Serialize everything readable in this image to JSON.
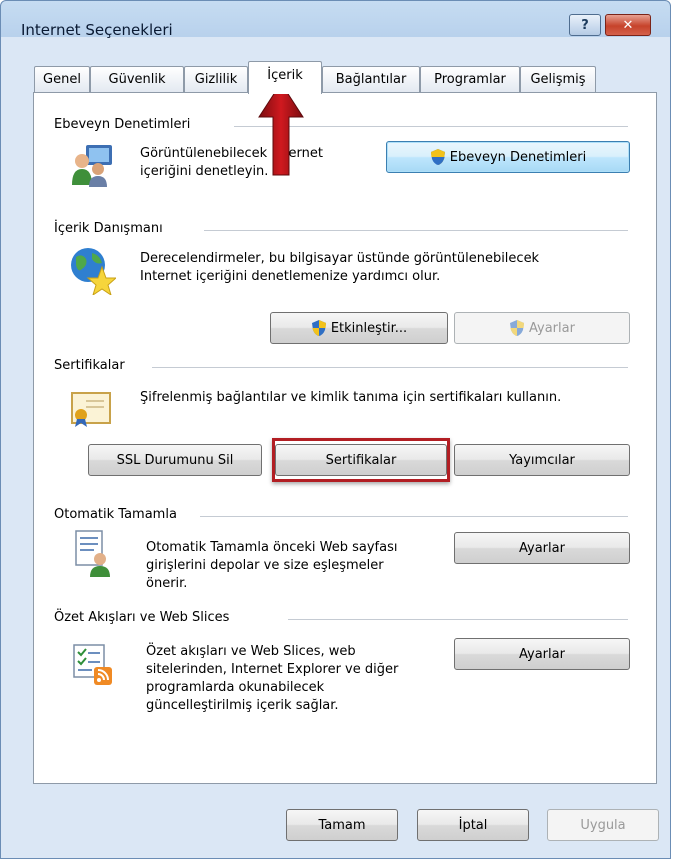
{
  "window": {
    "title": "Internet Seçenekleri",
    "help": "?",
    "close": "✕"
  },
  "tabs": [
    {
      "label": "Genel"
    },
    {
      "label": "Güvenlik"
    },
    {
      "label": "Gizlilik"
    },
    {
      "label": "İçerik"
    },
    {
      "label": "Bağlantılar"
    },
    {
      "label": "Programlar"
    },
    {
      "label": "Gelişmiş"
    }
  ],
  "parental": {
    "title": "Ebeveyn Denetimleri",
    "desc_line1": "Görüntülenebilecek Internet",
    "desc_line2": "içeriğini denetleyin.",
    "button": "Ebeveyn Denetimleri"
  },
  "advisor": {
    "title": "İçerik Danışmanı",
    "desc_line1": "Derecelendirmeler, bu bilgisayar üstünde görüntülenebilecek",
    "desc_line2": "Internet içeriğini denetlemenize yardımcı olur.",
    "enable_button": "Etkinleştir...",
    "settings_button": "Ayarlar"
  },
  "certificates": {
    "title": "Sertifikalar",
    "desc": "Şifrelenmiş bağlantılar ve kimlik tanıma için sertifikaları kullanın.",
    "ssl_button": "SSL Durumunu Sil",
    "certs_button": "Sertifikalar",
    "publishers_button": "Yayımcılar"
  },
  "autocomplete": {
    "title": "Otomatik Tamamla",
    "desc_line1": "Otomatik Tamamla önceki Web sayfası",
    "desc_line2": "girişlerini depolar ve size eşleşmeler",
    "desc_line3": "önerir.",
    "settings_button": "Ayarlar"
  },
  "feeds": {
    "title": "Özet Akışları ve Web Slices",
    "desc_line1": "Özet akışları ve Web Slices, web",
    "desc_line2": "sitelerinden, Internet Explorer ve diğer",
    "desc_line3": "programlarda okunabilecek",
    "desc_line4": "güncelleştirilmiş içerik sağlar.",
    "settings_button": "Ayarlar"
  },
  "footer": {
    "ok": "Tamam",
    "cancel": "İptal",
    "apply": "Uygula"
  },
  "colors": {
    "highlight": "#b21e23",
    "arrow": "#c0151b",
    "shield_blue": "#2f6fc4",
    "shield_yellow": "#f2c21b"
  }
}
